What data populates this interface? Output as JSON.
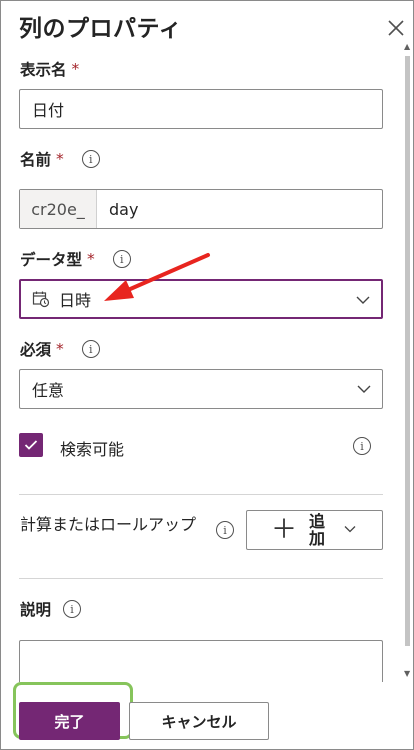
{
  "panel": {
    "title": "列のプロパティ"
  },
  "fields": {
    "display_name": {
      "label": "表示名",
      "required": "*",
      "value": "日付"
    },
    "name": {
      "label": "名前",
      "required": "*",
      "prefix": "cr20e_",
      "value": "day"
    },
    "data_type": {
      "label": "データ型",
      "required": "*",
      "value": "日時",
      "icon": "calendar-clock-icon"
    },
    "required_field": {
      "label": "必須",
      "required": "*",
      "value": "任意"
    },
    "searchable": {
      "label": "検索可能",
      "checked": true
    },
    "calculated": {
      "label": "計算またはロールアップ",
      "button_label": "追加"
    },
    "description": {
      "label": "説明",
      "value": ""
    }
  },
  "footer": {
    "done_label": "完了",
    "cancel_label": "キャンセル"
  },
  "colors": {
    "accent": "#742774",
    "required": "#a4262c",
    "highlight": "#86c45b",
    "annotation_arrow": "#e8251f"
  }
}
